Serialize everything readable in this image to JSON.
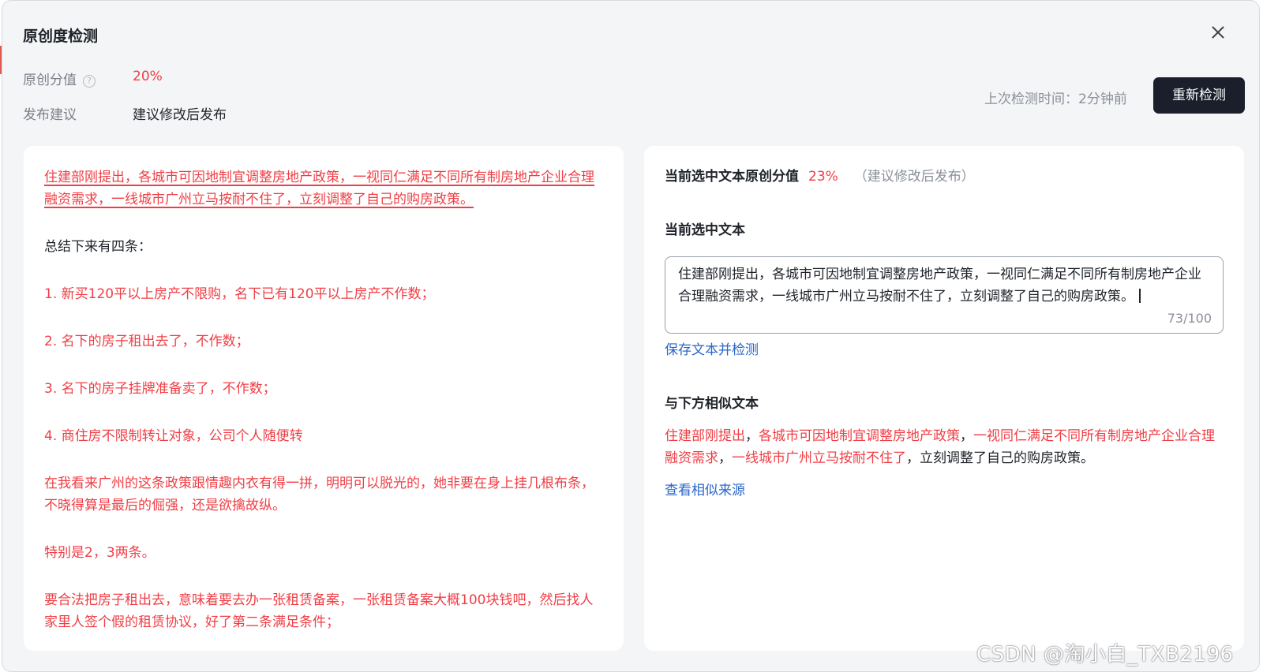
{
  "modal": {
    "title": "原创度检测",
    "close_icon": "close-icon"
  },
  "summary": {
    "score_label": "原创分值",
    "help_icon_glyph": "?",
    "score_value": "20%",
    "advice_label": "发布建议",
    "advice_value": "建议修改后发布",
    "last_check": "上次检测时间：2分钟前",
    "recheck_label": "重新检测"
  },
  "article": {
    "paragraphs": [
      {
        "text": "住建部刚提出，各城市可因地制宜调整房地产政策，一视同仁满足不同所有制房地产企业合理融资需求，一线城市广州立马按耐不住了，立刻调整了自己的购房政策。",
        "style": "selected"
      },
      {
        "text": "总结下来有四条：",
        "style": "black"
      },
      {
        "text": "1. 新买120平以上房产不限购，名下已有120平以上房产不作数；",
        "style": "red"
      },
      {
        "text": "2. 名下的房子租出去了，不作数；",
        "style": "red"
      },
      {
        "text": "3. 名下的房子挂牌准备卖了，不作数；",
        "style": "red"
      },
      {
        "text": "4. 商住房不限制转让对象，公司个人随便转",
        "style": "red"
      },
      {
        "text": "在我看来广州的这条政策跟情趣内衣有得一拼，明明可以脱光的，她非要在身上挂几根布条，不晓得算是最后的倔强，还是欲擒故纵。",
        "style": "red"
      },
      {
        "text": "特别是2，3两条。",
        "style": "red"
      },
      {
        "text": "要合法把房子租出去，意味着要去办一张租赁备案，一张租赁备案大概100块钱吧，然后找人家里人签个假的租赁协议，好了第二条满足条件；",
        "style": "red"
      }
    ]
  },
  "selection": {
    "heading": "当前选中文本原创分值",
    "score": "23%",
    "hint": "（建议修改后发布）",
    "text_heading": "当前选中文本",
    "text_value": "住建部刚提出，各城市可因地制宜调整房地产政策，一视同仁满足不同所有制房地产企业合理融资需求，一线城市广州立马按耐不住了，立刻调整了自己的购房政策。",
    "counter": "73/100",
    "save_link": "保存文本并检测",
    "similar_heading": "与下方相似文本",
    "similar_segments": [
      {
        "text": "住建部刚提出",
        "hl": true
      },
      {
        "text": "，",
        "hl": false
      },
      {
        "text": "各城市可因地制宜调整房地产政策",
        "hl": true
      },
      {
        "text": "，",
        "hl": false
      },
      {
        "text": "一视同仁满足不同所有制房地产企业合理融资需求",
        "hl": true
      },
      {
        "text": "，",
        "hl": false
      },
      {
        "text": "一线城市广州立马按耐不住了",
        "hl": true
      },
      {
        "text": "，立刻调整了自己的购房政策。",
        "hl": false
      }
    ],
    "source_link": "查看相似来源"
  },
  "watermark": "CSDN @淘小白_TXB2196",
  "colors": {
    "accent_red": "#f03e45",
    "link_blue": "#2b66c8",
    "button_dark": "#1a1f2b",
    "modal_bg": "#f4f5f7"
  }
}
